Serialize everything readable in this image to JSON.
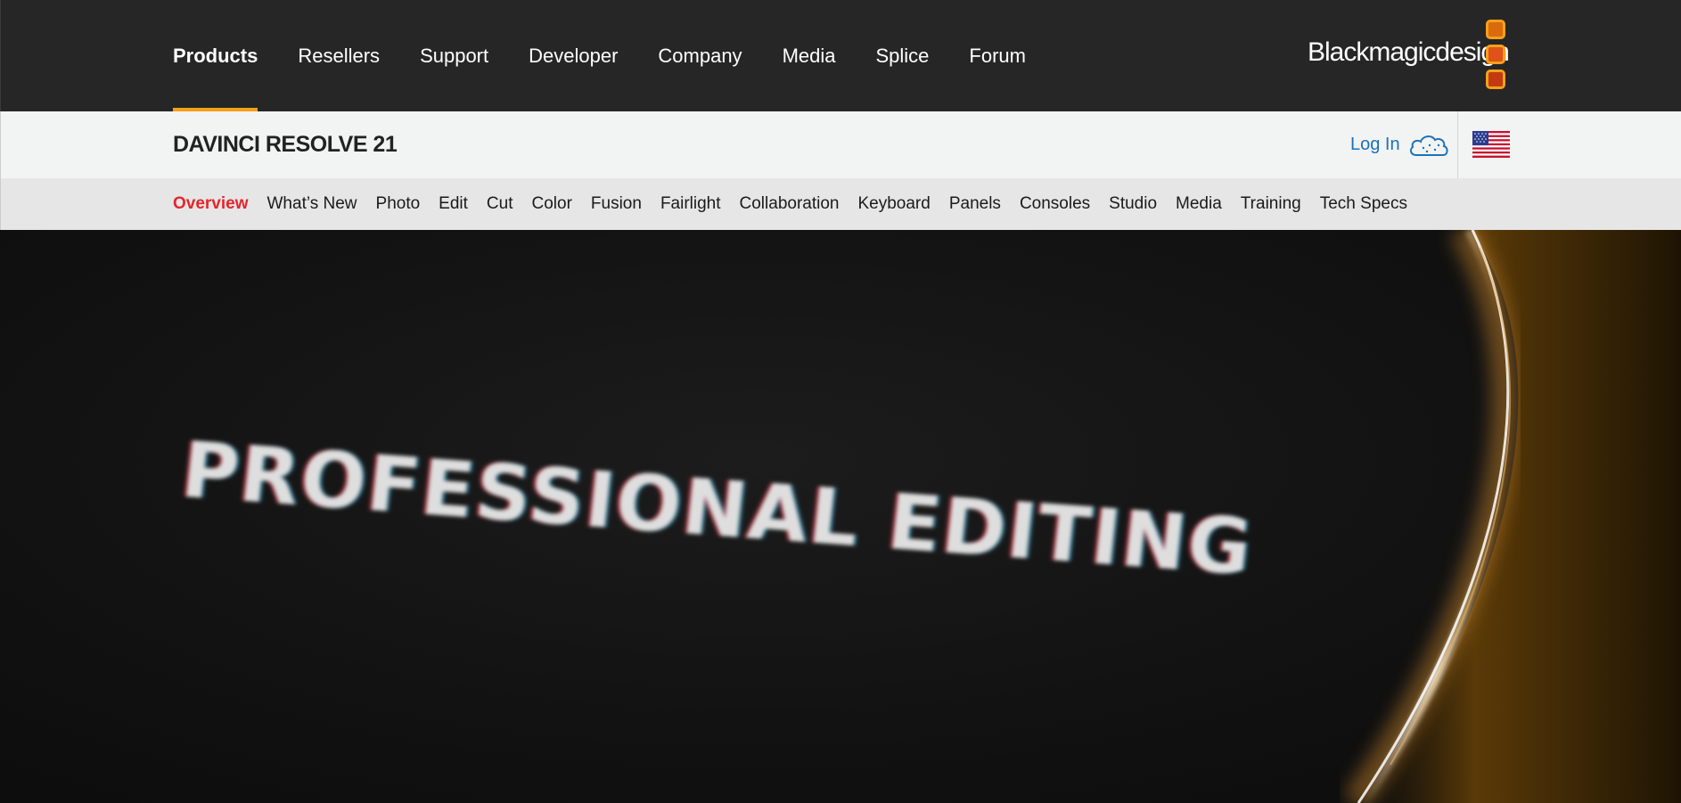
{
  "topnav": {
    "items": [
      {
        "label": "Products",
        "active": true
      },
      {
        "label": "Resellers"
      },
      {
        "label": "Support"
      },
      {
        "label": "Developer"
      },
      {
        "label": "Company"
      },
      {
        "label": "Media"
      },
      {
        "label": "Splice"
      },
      {
        "label": "Forum"
      }
    ]
  },
  "brand": {
    "logo_text": "Blackmagicdesign",
    "accent_color": "#f6a01a"
  },
  "product_bar": {
    "title": "DAVINCI RESOLVE 21",
    "login_label": "Log In",
    "login_icon": "cloud-icon",
    "region_icon": "us-flag-icon",
    "link_color": "#1b72b8"
  },
  "subnav": {
    "items": [
      {
        "label": "Overview",
        "active": true
      },
      {
        "label": "What’s New"
      },
      {
        "label": "Photo"
      },
      {
        "label": "Edit"
      },
      {
        "label": "Cut"
      },
      {
        "label": "Color"
      },
      {
        "label": "Fusion"
      },
      {
        "label": "Fairlight"
      },
      {
        "label": "Collaboration"
      },
      {
        "label": "Keyboard"
      },
      {
        "label": "Panels"
      },
      {
        "label": "Consoles"
      },
      {
        "label": "Studio"
      },
      {
        "label": "Media"
      },
      {
        "label": "Training"
      },
      {
        "label": "Tech Specs"
      }
    ],
    "active_color": "#e3262b"
  },
  "hero": {
    "headline": "PROFESSIONAL EDITING"
  }
}
